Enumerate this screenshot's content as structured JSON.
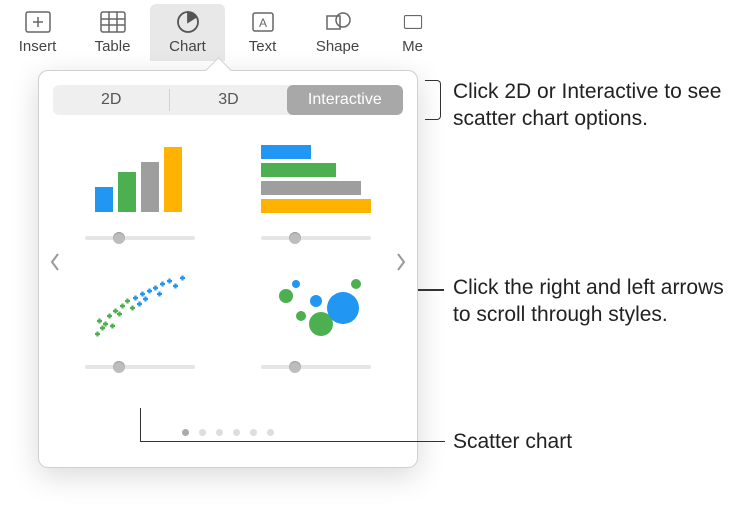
{
  "toolbar": {
    "items": [
      {
        "label": "Insert"
      },
      {
        "label": "Table"
      },
      {
        "label": "Chart"
      },
      {
        "label": "Text"
      },
      {
        "label": "Shape"
      },
      {
        "label": "Me"
      }
    ]
  },
  "popover": {
    "tabs": {
      "t2d": "2D",
      "t3d": "3D",
      "tint": "Interactive"
    },
    "thumbs": {
      "a": "column-chart",
      "b": "bar-chart",
      "c": "scatter-chart",
      "d": "bubble-chart"
    }
  },
  "callouts": {
    "tabs": "Click 2D or Interactive to see scatter chart options.",
    "arrows": "Click the right and left arrows to scroll through styles.",
    "scatter": "Scatter chart"
  }
}
